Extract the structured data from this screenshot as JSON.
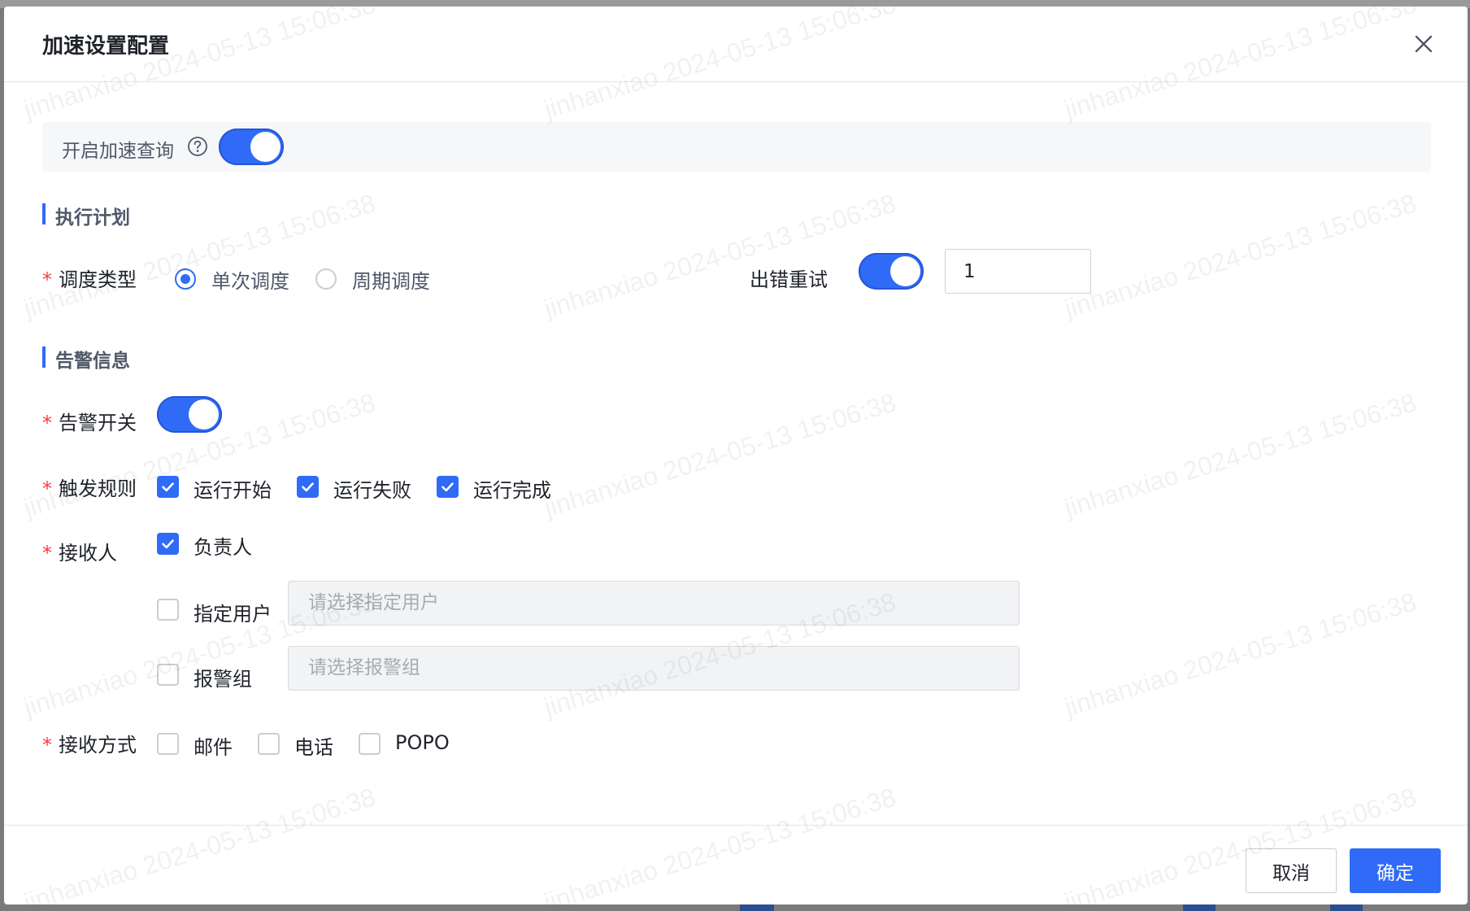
{
  "dialog": {
    "title": "加速设置配置",
    "accelerate_query": {
      "label": "开启加速查询",
      "enabled": true
    },
    "execution_plan": {
      "section_title": "执行计划",
      "schedule_type": {
        "label": "调度类型",
        "options": [
          "单次调度",
          "周期调度"
        ],
        "selected": "单次调度"
      },
      "retry_on_error": {
        "label": "出错重试",
        "enabled": true,
        "value": "1"
      }
    },
    "alert_info": {
      "section_title": "告警信息",
      "alert_switch": {
        "label": "告警开关",
        "enabled": true
      },
      "trigger_rules": {
        "label": "触发规则",
        "options": [
          {
            "label": "运行开始",
            "checked": true
          },
          {
            "label": "运行失败",
            "checked": true
          },
          {
            "label": "运行完成",
            "checked": true
          }
        ]
      },
      "recipients": {
        "label": "接收人",
        "owner": {
          "label": "负责人",
          "checked": true
        },
        "specified_user": {
          "label": "指定用户",
          "checked": false,
          "placeholder": "请选择指定用户"
        },
        "alert_group": {
          "label": "报警组",
          "checked": false,
          "placeholder": "请选择报警组"
        }
      },
      "receive_methods": {
        "label": "接收方式",
        "options": [
          {
            "label": "邮件",
            "checked": false
          },
          {
            "label": "电话",
            "checked": false
          },
          {
            "label": "POPO",
            "checked": false
          }
        ]
      }
    },
    "footer": {
      "cancel_label": "取消",
      "confirm_label": "确定"
    }
  },
  "watermark": "jinhanxiao 2024-05-13 15:06:38",
  "colors": {
    "primary": "#2f6bf6",
    "required": "#f53f3f"
  }
}
